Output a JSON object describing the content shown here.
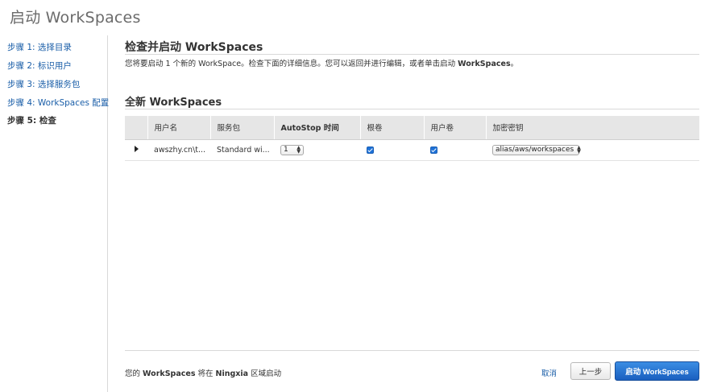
{
  "page": {
    "title": "启动 WorkSpaces"
  },
  "sidebar": {
    "steps": [
      {
        "label": "步骤 1: 选择目录"
      },
      {
        "label": "步骤 2: 标识用户"
      },
      {
        "label": "步骤 3: 选择服务包"
      },
      {
        "label": "步骤 4: WorkSpaces 配置"
      },
      {
        "label": "步骤 5: 检查"
      }
    ]
  },
  "review": {
    "title": "检查并启动 WorkSpaces",
    "desc_pre": "您将要启动 1 个新的 WorkSpace。检查下面的详细信息。您可以返回并进行编辑，或者单击启动 ",
    "desc_bold": "WorkSpaces",
    "desc_post": "。"
  },
  "table": {
    "section_title": "全新 WorkSpaces",
    "headers": [
      "用户名",
      "服务包",
      "AutoStop 时间",
      "根卷",
      "用户卷",
      "加密密钥"
    ],
    "rows": [
      {
        "username": "awszhy.cn\\t...",
        "bundle": "Standard wi...",
        "autostop": "1",
        "root_volume_checked": true,
        "user_volume_checked": true,
        "encryption_key": "alias/aws/workspaces"
      }
    ]
  },
  "footer": {
    "text_pre": "您的 ",
    "text_bold1": "WorkSpaces",
    "text_mid": " 将在 ",
    "text_bold2": "Ningxia",
    "text_post": " 区域启动",
    "cancel_label": "取消",
    "prev_label": "上一步",
    "launch_label": "启动 WorkSpaces"
  },
  "colors": {
    "link": "#1a5ea8",
    "primary_button": "#1a5fbf",
    "header_bg": "#e6e6e6"
  }
}
